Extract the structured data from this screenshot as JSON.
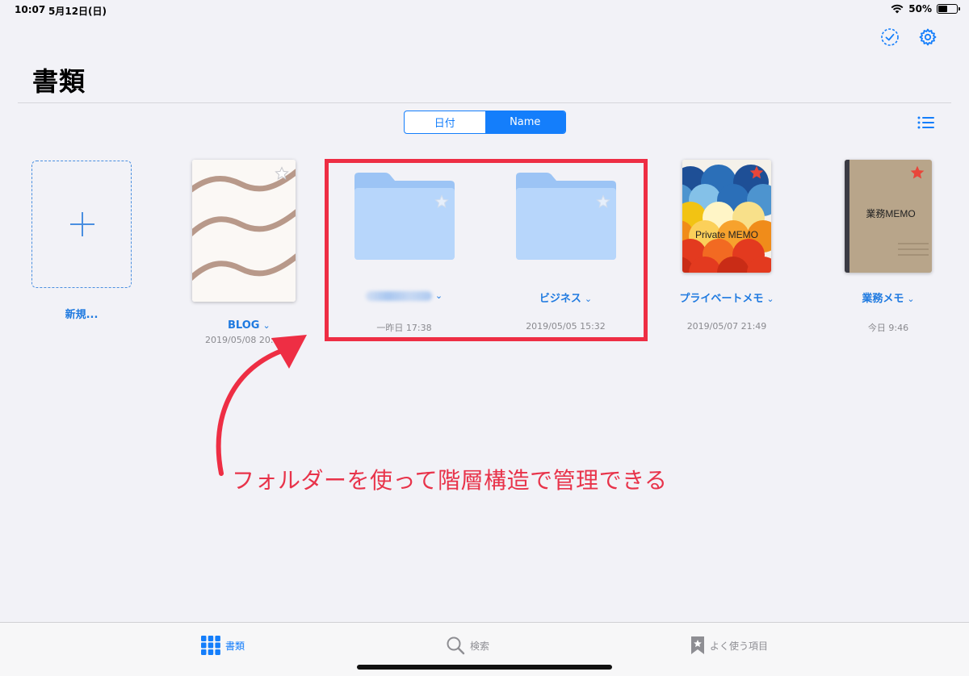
{
  "status_bar": {
    "time": "10:07",
    "date": "5月12日(日)",
    "battery": "50%",
    "battery_level": 0.5
  },
  "header": {
    "title": "書類",
    "select_icon": "checkmark-circle-icon",
    "settings_icon": "gear-icon"
  },
  "sort_control": {
    "options": [
      "日付",
      "Name"
    ],
    "selected": "Name"
  },
  "view_toggle": {
    "icon": "list-icon"
  },
  "new_document": {
    "label": "新規..."
  },
  "items": [
    {
      "label": "BLOG",
      "date": "2019/05/08 20:",
      "type": "document",
      "starred": false
    },
    {
      "label": "",
      "date": "一昨日 17:38",
      "type": "folder",
      "starred": false
    },
    {
      "label": "ビジネス",
      "date": "2019/05/05 15:32",
      "type": "folder",
      "starred": false
    },
    {
      "label": "プライベートメモ",
      "date": "2019/05/07 21:49",
      "type": "notebook",
      "cover_text": "Private MEMO",
      "starred": true
    },
    {
      "label": "業務メモ",
      "date": "今日 9:46",
      "type": "notebook",
      "cover_text": "業務MEMO",
      "starred": true
    }
  ],
  "annotation": {
    "text": "フォルダーを使って階層構造で管理できる",
    "color": "#e8334a"
  },
  "tab_bar": {
    "tabs": [
      {
        "label": "書類",
        "icon": "grid-icon",
        "active": true
      },
      {
        "label": "検索",
        "icon": "search-icon",
        "active": false
      },
      {
        "label": "よく使う項目",
        "icon": "bookmark-star-icon",
        "active": false
      }
    ]
  },
  "colors": {
    "accent": "#147efb",
    "highlight": "#ee2e44",
    "folder": "#b7d6fb"
  }
}
